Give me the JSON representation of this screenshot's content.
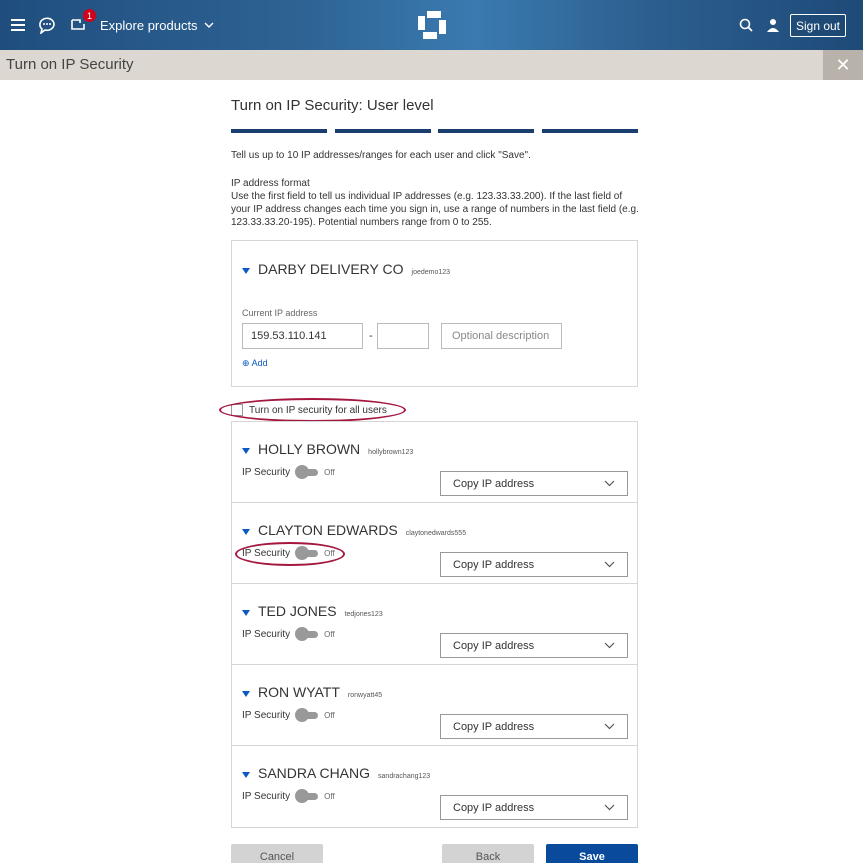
{
  "header": {
    "explore_label": "Explore products",
    "badge_count": "1",
    "sign_out_label": "Sign out",
    "icons": [
      "hamburger-icon",
      "chat-icon",
      "inbox-icon",
      "chevron-down-icon",
      "chase-logo",
      "search-icon",
      "user-icon"
    ]
  },
  "titlebar": {
    "title": "Turn on IP Security",
    "close_glyph": "✕"
  },
  "page": {
    "heading": "Turn on IP Security: User level",
    "instruction": "Tell us up to 10 IP addresses/ranges for each user and click \"Save\".",
    "format_title": "IP address format",
    "format_body": "Use the first field to tell us individual IP addresses (e.g. 123.33.33.200). If the last field of your IP address changes each time you sign in, use a range of numbers in the last field (e.g. 123.33.33.20-195). Potential numbers range from 0 to 255."
  },
  "company": {
    "name": "DARBY DELIVERY CO",
    "user_id": "joedemo123",
    "current_ip_label": "Current IP address",
    "ip_value": "159.53.110.141",
    "dash": "-",
    "description_placeholder": "Optional description",
    "add_label": "Add"
  },
  "all_users": {
    "label": "Turn on IP security for all users",
    "checked": false
  },
  "users": [
    {
      "name": "HOLLY BROWN",
      "user_id": "hollybrown123",
      "ip_security_label": "IP Security",
      "state": "Off",
      "copy_label": "Copy IP address"
    },
    {
      "name": "CLAYTON EDWARDS",
      "user_id": "claytonedwards555",
      "ip_security_label": "IP Security",
      "state": "Off",
      "copy_label": "Copy IP address"
    },
    {
      "name": "TED JONES",
      "user_id": "tedjones123",
      "ip_security_label": "IP Security",
      "state": "Off",
      "copy_label": "Copy IP address"
    },
    {
      "name": "RON WYATT",
      "user_id": "ronwyatt45",
      "ip_security_label": "IP Security",
      "state": "Off",
      "copy_label": "Copy IP address"
    },
    {
      "name": "SANDRA CHANG",
      "user_id": "sandrachang123",
      "ip_security_label": "IP Security",
      "state": "Off",
      "copy_label": "Copy IP address"
    }
  ],
  "buttons": {
    "cancel": "Cancel",
    "back": "Back",
    "save": "Save"
  },
  "colors": {
    "accent": "#0a4a9c",
    "highlight_oval": "#a4173f",
    "step_bar": "#1a3e6e"
  }
}
